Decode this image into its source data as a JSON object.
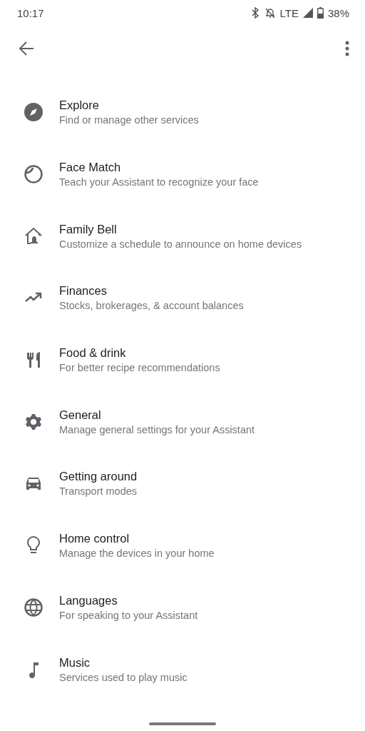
{
  "status_bar": {
    "time": "10:17",
    "network": "LTE",
    "battery": "38%"
  },
  "items": [
    {
      "kind": "compass",
      "title": "Explore",
      "subtitle": "Find or manage other services"
    },
    {
      "kind": "face",
      "title": "Face Match",
      "subtitle": "Teach your Assistant to recognize your face"
    },
    {
      "kind": "home-bell",
      "title": "Family Bell",
      "subtitle": "Customize a schedule to announce on home devices"
    },
    {
      "kind": "trend",
      "title": "Finances",
      "subtitle": "Stocks, brokerages, & account balances"
    },
    {
      "kind": "fork-knife",
      "title": "Food & drink",
      "subtitle": "For better recipe recommendations"
    },
    {
      "kind": "gear",
      "title": "General",
      "subtitle": "Manage general settings for your Assistant"
    },
    {
      "kind": "car",
      "title": "Getting around",
      "subtitle": "Transport modes"
    },
    {
      "kind": "bulb",
      "title": "Home control",
      "subtitle": "Manage the devices in your home"
    },
    {
      "kind": "globe",
      "title": "Languages",
      "subtitle": "For speaking to your Assistant"
    },
    {
      "kind": "note",
      "title": "Music",
      "subtitle": "Services used to play music"
    }
  ]
}
